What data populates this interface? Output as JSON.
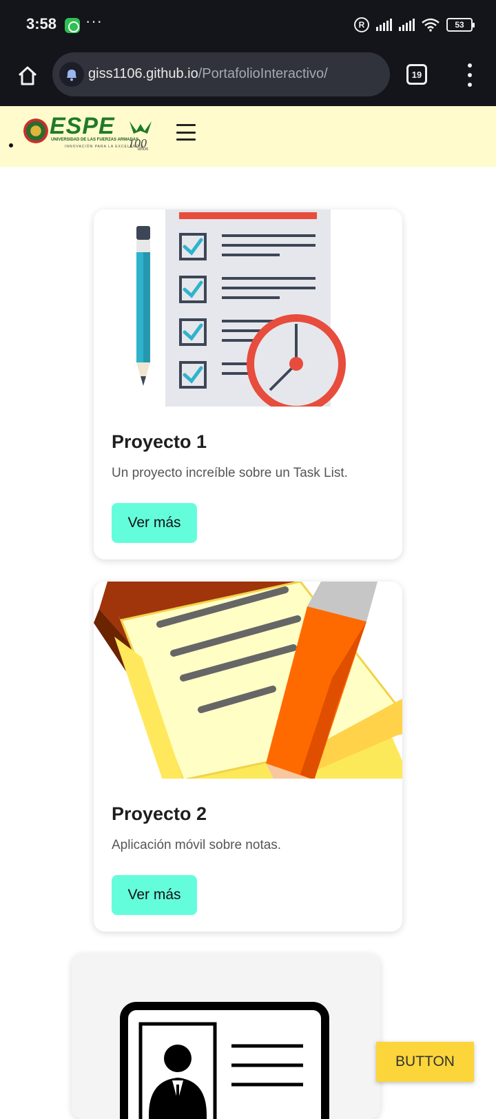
{
  "status_bar": {
    "time": "3:58",
    "more": "···",
    "r_badge": "R",
    "battery": "53"
  },
  "browser": {
    "url_host": "giss1106.github.io",
    "url_path": "/PortafolioInteractivo/",
    "tab_count": "19"
  },
  "header": {
    "logo_text": "ESPE",
    "logo_subtitle": "UNIVERSIDAD DE LAS FUERZAS ARMADAS",
    "logo_tagline": "INNOVACIÓN PARA LA EXCELENCIA",
    "logo_years": "años"
  },
  "projects": [
    {
      "title": "Proyecto 1",
      "description": "Un proyecto increíble sobre un Task List.",
      "button": "Ver más"
    },
    {
      "title": "Proyecto 2",
      "description": "Aplicación móvil sobre notas.",
      "button": "Ver más"
    }
  ],
  "floating_button": "BUTTON",
  "colors": {
    "header_bg": "#fffbcc",
    "card_button": "#64fddc",
    "floating_button": "#fcd53b",
    "status_bar_bg": "#13151b"
  }
}
